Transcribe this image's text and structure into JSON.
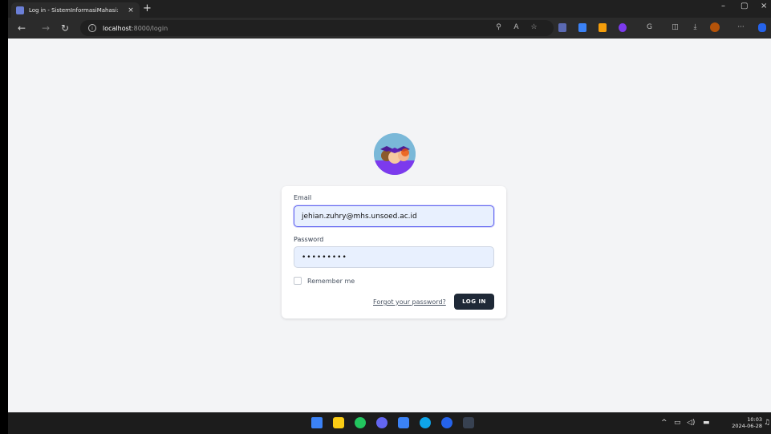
{
  "browser": {
    "tab_title": "Log in - SistemInformasiMahasi:",
    "tab_close": "×",
    "new_tab": "+",
    "url_host": "localhost",
    "url_path": ":8000/login",
    "window_controls": [
      "–",
      "▢",
      "×"
    ]
  },
  "login": {
    "email_label": "Email",
    "email_value": "jehian.zuhry@mhs.unsoed.ac.id",
    "password_label": "Password",
    "password_value": "•••••••••",
    "remember_label": "Remember me",
    "forgot_link": "Forgot your password?",
    "login_button": "LOG IN"
  },
  "taskbar": {
    "time": "10:03",
    "date": "2024-06-28"
  },
  "colors": {
    "page_bg": "#f3f4f6",
    "button_bg": "#1f2937",
    "input_bg": "#e8f0fe",
    "focus_ring": "#6366f1"
  }
}
